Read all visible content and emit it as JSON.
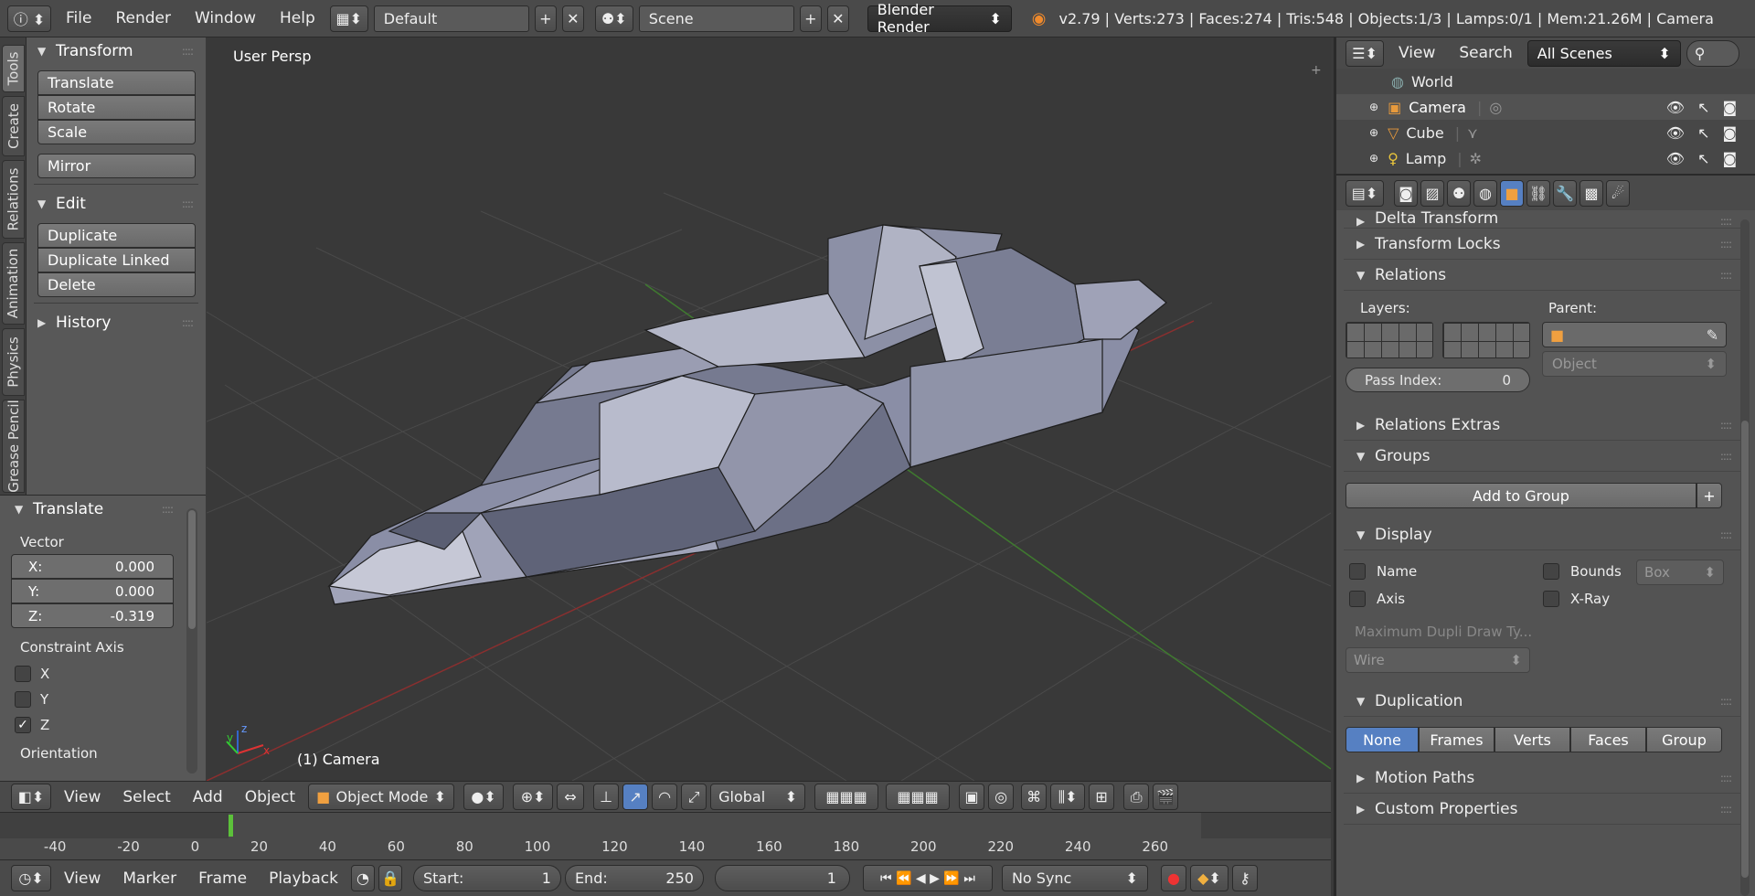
{
  "topbar": {
    "menus": [
      "File",
      "Render",
      "Window",
      "Help"
    ],
    "layout": "Default",
    "scene": "Scene",
    "engine": "Blender Render",
    "stats": "v2.79 | Verts:273 | Faces:274 | Tris:548 | Objects:1/3 | Lamps:0/1 | Mem:21.26M | Camera"
  },
  "left_tabs": [
    "Tools",
    "Create",
    "Relations",
    "Animation",
    "Physics",
    "Grease Pencil"
  ],
  "toolshelf": {
    "transform_title": "Transform",
    "translate": "Translate",
    "rotate": "Rotate",
    "scale": "Scale",
    "mirror": "Mirror",
    "edit_title": "Edit",
    "duplicate": "Duplicate",
    "duplicate_linked": "Duplicate Linked",
    "delete": "Delete",
    "history_title": "History"
  },
  "operator": {
    "title": "Translate",
    "vector_label": "Vector",
    "x_label": "X:",
    "x_value": "0.000",
    "y_label": "Y:",
    "y_value": "0.000",
    "z_label": "Z:",
    "z_value": "-0.319",
    "constraint_label": "Constraint Axis",
    "cx": "X",
    "cy": "Y",
    "cz": "Z",
    "cx_checked": false,
    "cy_checked": false,
    "cz_checked": true,
    "orientation_label": "Orientation"
  },
  "viewport": {
    "view_name": "User Persp",
    "object_label": "(1) Camera",
    "axis_x": "x",
    "axis_y": "y",
    "axis_z": "z"
  },
  "view3d_header": {
    "menus": [
      "View",
      "Select",
      "Add",
      "Object"
    ],
    "mode": "Object Mode",
    "orientation": "Global"
  },
  "timeline": {
    "ticks": [
      "-40",
      "-20",
      "0",
      "20",
      "40",
      "60",
      "80",
      "100",
      "120",
      "140",
      "160",
      "180",
      "200",
      "220",
      "240",
      "260"
    ],
    "menus": [
      "View",
      "Marker",
      "Frame",
      "Playback"
    ],
    "start_label": "Start:",
    "start_value": "1",
    "end_label": "End:",
    "end_value": "250",
    "current_frame": "1",
    "sync": "No Sync"
  },
  "outliner": {
    "menus": [
      "View",
      "Search"
    ],
    "filter": "All Scenes",
    "items": [
      "World",
      "Camera",
      "Cube",
      "Lamp"
    ]
  },
  "properties": {
    "delta_transform": "Delta Transform",
    "transform_locks": "Transform Locks",
    "relations": "Relations",
    "layers_label": "Layers:",
    "parent_label": "Parent:",
    "parent_type": "Object",
    "pass_index_label": "Pass Index:",
    "pass_index_value": "0",
    "relations_extras": "Relations Extras",
    "groups": "Groups",
    "add_to_group": "Add to Group",
    "display": "Display",
    "name_label": "Name",
    "axis_label": "Axis",
    "bounds_label": "Bounds",
    "bounds_type": "Box",
    "xray_label": "X-Ray",
    "max_dupli_label": "Maximum Dupli Draw Ty...",
    "max_dupli_value": "Wire",
    "duplication": "Duplication",
    "dup_options": [
      "None",
      "Frames",
      "Verts",
      "Faces",
      "Group"
    ],
    "motion_paths": "Motion Paths",
    "custom_properties": "Custom Properties"
  },
  "colors": {
    "accent": "#5680c2",
    "background": "#393939",
    "panel": "#585858"
  }
}
